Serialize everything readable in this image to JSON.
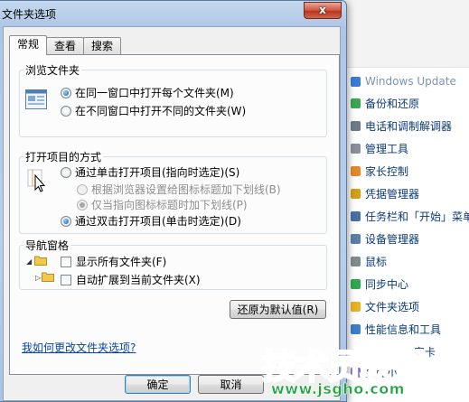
{
  "dialog": {
    "title": "文件夹选项",
    "close_glyph": "x",
    "tabs": [
      {
        "label": "常规"
      },
      {
        "label": "查看"
      },
      {
        "label": "搜索"
      }
    ],
    "browse_group": {
      "label": "浏览文件夹",
      "options": [
        {
          "label": "在同一窗口中打开每个文件夹(M)",
          "selected": true
        },
        {
          "label": "在不同窗口中打开不同的文件夹(W)",
          "selected": false
        }
      ]
    },
    "open_group": {
      "label": "打开项目的方式",
      "single_click": "通过单击打开项目(指向时选定)(S)",
      "underline_browser": "根据浏览器设置给图标标题加下划线(B)",
      "underline_hover": "仅当指向图标标题时加下划线(P)",
      "double_click": "通过双击打开项目(单击时选定)(D)",
      "selected": "double_click"
    },
    "nav_group": {
      "label": "导航窗格",
      "show_all": "显示所有文件夹(F)",
      "auto_expand": "自动扩展到当前文件夹(X)"
    },
    "restore_button": "还原为默认值(R)",
    "help_link": "我如何更改文件夹选项?",
    "ok_button": "确定",
    "cancel_button": "取消"
  },
  "control_panel": {
    "items": [
      {
        "label": "Windows Update",
        "color": "#3a7bd5"
      },
      {
        "label": "备份和还原",
        "color": "#3aa757"
      },
      {
        "label": "电话和调制解调器",
        "color": "#6b7b8c"
      },
      {
        "label": "管理工具",
        "color": "#8a8f99"
      },
      {
        "label": "家长控制",
        "color": "#e08a2c"
      },
      {
        "label": "凭据管理器",
        "color": "#d4a017"
      },
      {
        "label": "任务栏和「开始」菜单",
        "color": "#4a6fa5"
      },
      {
        "label": "设备管理器",
        "color": "#5a7fa8"
      },
      {
        "label": "鼠标",
        "color": "#7f8c8d"
      },
      {
        "label": "同步中心",
        "color": "#2fa84f"
      },
      {
        "label": "文件夹选项",
        "color": "#e6b422"
      },
      {
        "label": "性能信息和工具",
        "color": "#3d7dca"
      },
      {
        "label": "安卡",
        "color": "#5b86c4"
      },
      {
        "label": "桌面小",
        "color": "#8a6fc4"
      }
    ]
  },
  "watermark": {
    "logo_chars": [
      "技",
      "术",
      "员",
      "联",
      "盟"
    ],
    "url": "www.jsgho.com",
    "color": "#20a33a"
  }
}
